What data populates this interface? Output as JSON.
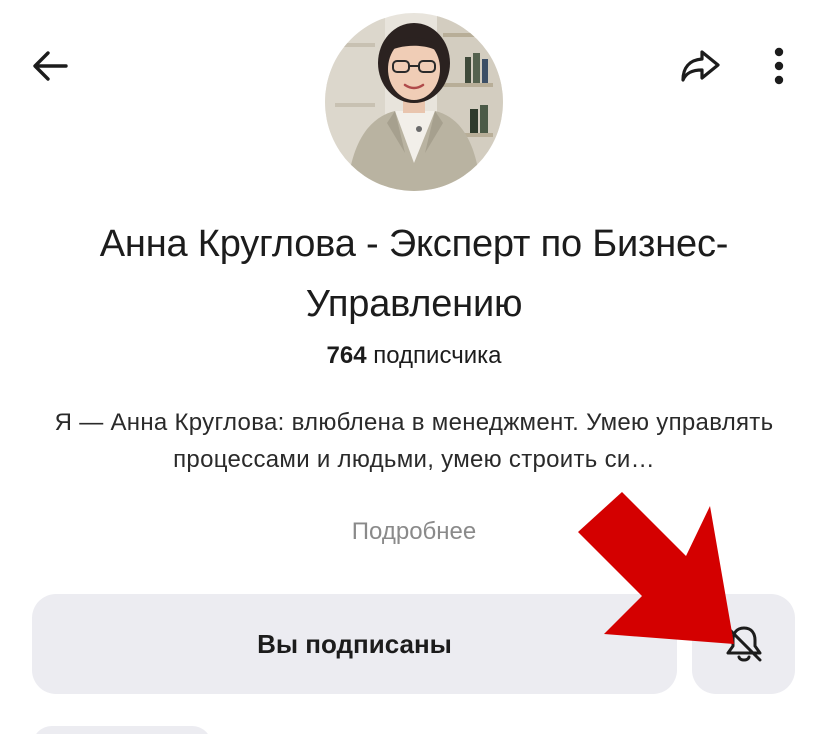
{
  "header": {
    "back_icon": "arrow-left-icon",
    "share_icon": "share-arrow-icon",
    "more_icon": "vertical-dots-icon"
  },
  "profile": {
    "title": "Анна Круглова - Эксперт по Бизнес-Управлению",
    "subscribers_count": "764",
    "subscribers_label": "подписчика",
    "description": "Я — Анна Круглова: влюблена в менеджмент. Умею управлять процессами и людьми, умею строить си…",
    "more_link": "Подробнее"
  },
  "actions": {
    "subscribed_label": "Вы подписаны",
    "bell_icon": "bell-off-icon"
  },
  "annotation": {
    "color": "#d40000"
  }
}
